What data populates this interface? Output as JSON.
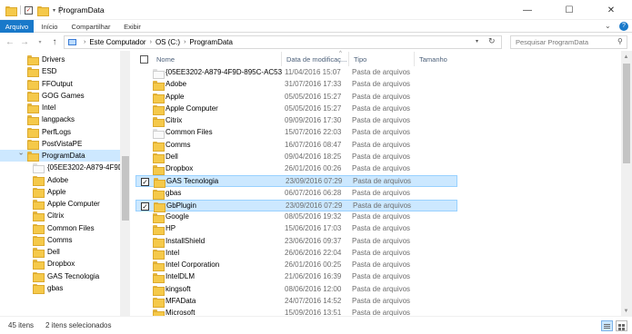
{
  "window": {
    "title": "ProgramData",
    "minimize": "—",
    "maximize": "☐",
    "close": "✕"
  },
  "ribbon": {
    "tabs": [
      "Arquivo",
      "Início",
      "Compartilhar",
      "Exibir"
    ],
    "active": "Arquivo"
  },
  "address": {
    "crumbs": [
      "Este Computador",
      "OS (C:)",
      "ProgramData"
    ],
    "search_placeholder": "Pesquisar ProgramData"
  },
  "columns": [
    "Nome",
    "Data de modificaç...",
    "Tipo",
    "Tamanho"
  ],
  "nav_tree": [
    {
      "label": "Drivers"
    },
    {
      "label": "ESD"
    },
    {
      "label": "FFOutput"
    },
    {
      "label": "GOG Games"
    },
    {
      "label": "Intel"
    },
    {
      "label": "langpacks"
    },
    {
      "label": "PerfLogs"
    },
    {
      "label": "PostVistaPE"
    },
    {
      "label": "ProgramData",
      "selected": true
    },
    {
      "label": "{05EE3202-A879-4F9D-89",
      "white": true,
      "indent": true
    },
    {
      "label": "Adobe",
      "indent": true
    },
    {
      "label": "Apple",
      "indent": true
    },
    {
      "label": "Apple Computer",
      "indent": true
    },
    {
      "label": "Citrix",
      "indent": true
    },
    {
      "label": "Common Files",
      "indent": true
    },
    {
      "label": "Comms",
      "indent": true
    },
    {
      "label": "Dell",
      "indent": true
    },
    {
      "label": "Dropbox",
      "indent": true
    },
    {
      "label": "GAS Tecnologia",
      "indent": true
    },
    {
      "label": "gbas",
      "indent": true
    }
  ],
  "files": [
    {
      "name": "{05EE3202-A879-4F9D-895C-AC535859...",
      "date": "11/04/2016 15:07",
      "type": "Pasta de arquivos",
      "white": true
    },
    {
      "name": "Adobe",
      "date": "31/07/2016 17:33",
      "type": "Pasta de arquivos"
    },
    {
      "name": "Apple",
      "date": "05/05/2016 15:27",
      "type": "Pasta de arquivos"
    },
    {
      "name": "Apple Computer",
      "date": "05/05/2016 15:27",
      "type": "Pasta de arquivos"
    },
    {
      "name": "Citrix",
      "date": "09/09/2016 17:30",
      "type": "Pasta de arquivos"
    },
    {
      "name": "Common Files",
      "date": "15/07/2016 22:03",
      "type": "Pasta de arquivos",
      "white": true
    },
    {
      "name": "Comms",
      "date": "16/07/2016 08:47",
      "type": "Pasta de arquivos"
    },
    {
      "name": "Dell",
      "date": "09/04/2016 18:25",
      "type": "Pasta de arquivos"
    },
    {
      "name": "Dropbox",
      "date": "26/01/2016 00:26",
      "type": "Pasta de arquivos"
    },
    {
      "name": "GAS Tecnologia",
      "date": "23/09/2016 07:29",
      "type": "Pasta de arquivos",
      "selected": true
    },
    {
      "name": "gbas",
      "date": "06/07/2016 06:28",
      "type": "Pasta de arquivos"
    },
    {
      "name": "GbPlugin",
      "date": "23/09/2016 07:29",
      "type": "Pasta de arquivos",
      "selected": true
    },
    {
      "name": "Google",
      "date": "08/05/2016 19:32",
      "type": "Pasta de arquivos"
    },
    {
      "name": "HP",
      "date": "15/06/2016 17:03",
      "type": "Pasta de arquivos"
    },
    {
      "name": "InstallShield",
      "date": "23/06/2016 09:37",
      "type": "Pasta de arquivos"
    },
    {
      "name": "Intel",
      "date": "26/06/2016 22:04",
      "type": "Pasta de arquivos"
    },
    {
      "name": "Intel Corporation",
      "date": "26/01/2016 00:25",
      "type": "Pasta de arquivos"
    },
    {
      "name": "IntelDLM",
      "date": "21/06/2016 16:39",
      "type": "Pasta de arquivos"
    },
    {
      "name": "kingsoft",
      "date": "08/06/2016 12:00",
      "type": "Pasta de arquivos"
    },
    {
      "name": "MFAData",
      "date": "24/07/2016 14:52",
      "type": "Pasta de arquivos"
    },
    {
      "name": "Microsoft",
      "date": "15/09/2016 13:51",
      "type": "Pasta de arquivos"
    }
  ],
  "status": {
    "count": "45 itens",
    "selected": "2 itens selecionados"
  },
  "colors": {
    "accent": "#1979ca",
    "selection": "#cce8ff",
    "folder": "#f5c94a"
  }
}
